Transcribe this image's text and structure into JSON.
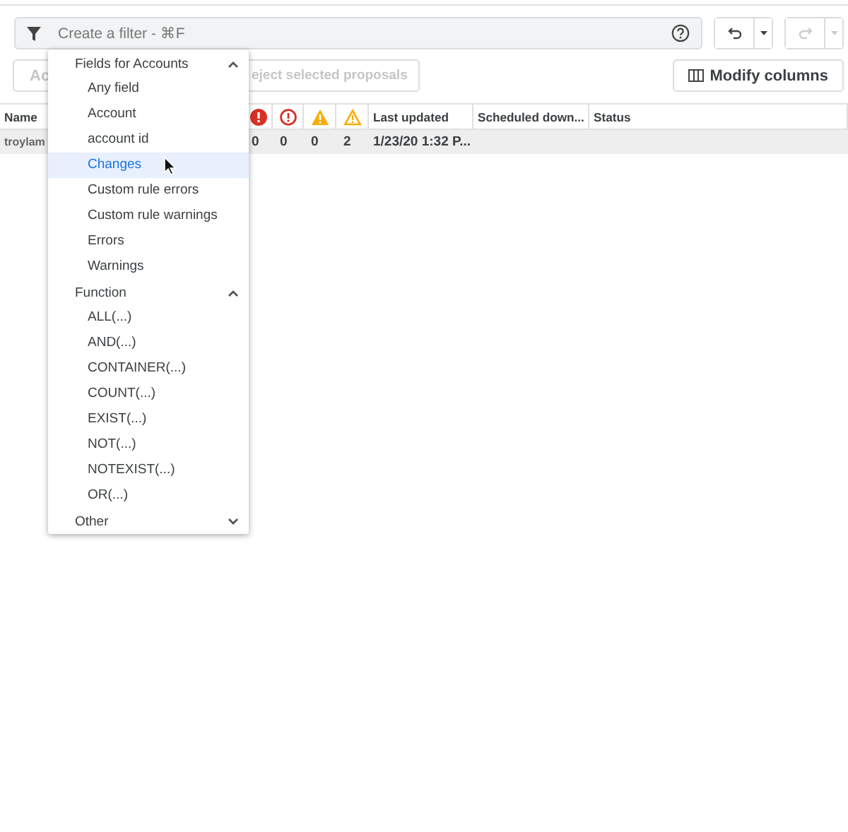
{
  "filter": {
    "placeholder": "Create a filter - ⌘F"
  },
  "actions": [
    {
      "label": "Ac",
      "disabled": true
    },
    {
      "label": "eject selected proposals",
      "disabled": true
    }
  ],
  "modify_columns": {
    "label": "Modify columns"
  },
  "table": {
    "columns": [
      {
        "kind": "text",
        "label": "Name"
      },
      {
        "kind": "error"
      },
      {
        "kind": "error-outline"
      },
      {
        "kind": "warning"
      },
      {
        "kind": "warning-outline"
      },
      {
        "kind": "text",
        "label": "Last updated"
      },
      {
        "kind": "text",
        "label": "Scheduled down..."
      },
      {
        "kind": "text",
        "label": "Status"
      }
    ],
    "rows": [
      {
        "cells": [
          "troylam",
          "0",
          "0",
          "0",
          "2",
          "1/23/20 1:32 P...",
          "",
          ""
        ]
      }
    ]
  },
  "dropdown": {
    "groups": [
      {
        "label": "Fields for Accounts",
        "expanded": true,
        "items": [
          {
            "label": "Any field",
            "selected": false
          },
          {
            "label": "Account",
            "selected": false
          },
          {
            "label": "account id",
            "selected": false
          },
          {
            "label": "Changes",
            "selected": true
          },
          {
            "label": "Custom rule errors",
            "selected": false
          },
          {
            "label": "Custom rule warnings",
            "selected": false
          },
          {
            "label": "Errors",
            "selected": false
          },
          {
            "label": "Warnings",
            "selected": false
          }
        ]
      },
      {
        "label": "Function",
        "expanded": true,
        "items": [
          {
            "label": "ALL(...)",
            "selected": false
          },
          {
            "label": "AND(...)",
            "selected": false
          },
          {
            "label": "CONTAINER(...)",
            "selected": false
          },
          {
            "label": "COUNT(...)",
            "selected": false
          },
          {
            "label": "EXIST(...)",
            "selected": false
          },
          {
            "label": "NOT(...)",
            "selected": false
          },
          {
            "label": "NOTEXIST(...)",
            "selected": false
          },
          {
            "label": "OR(...)",
            "selected": false
          }
        ]
      },
      {
        "label": "Other",
        "expanded": false
      }
    ]
  }
}
